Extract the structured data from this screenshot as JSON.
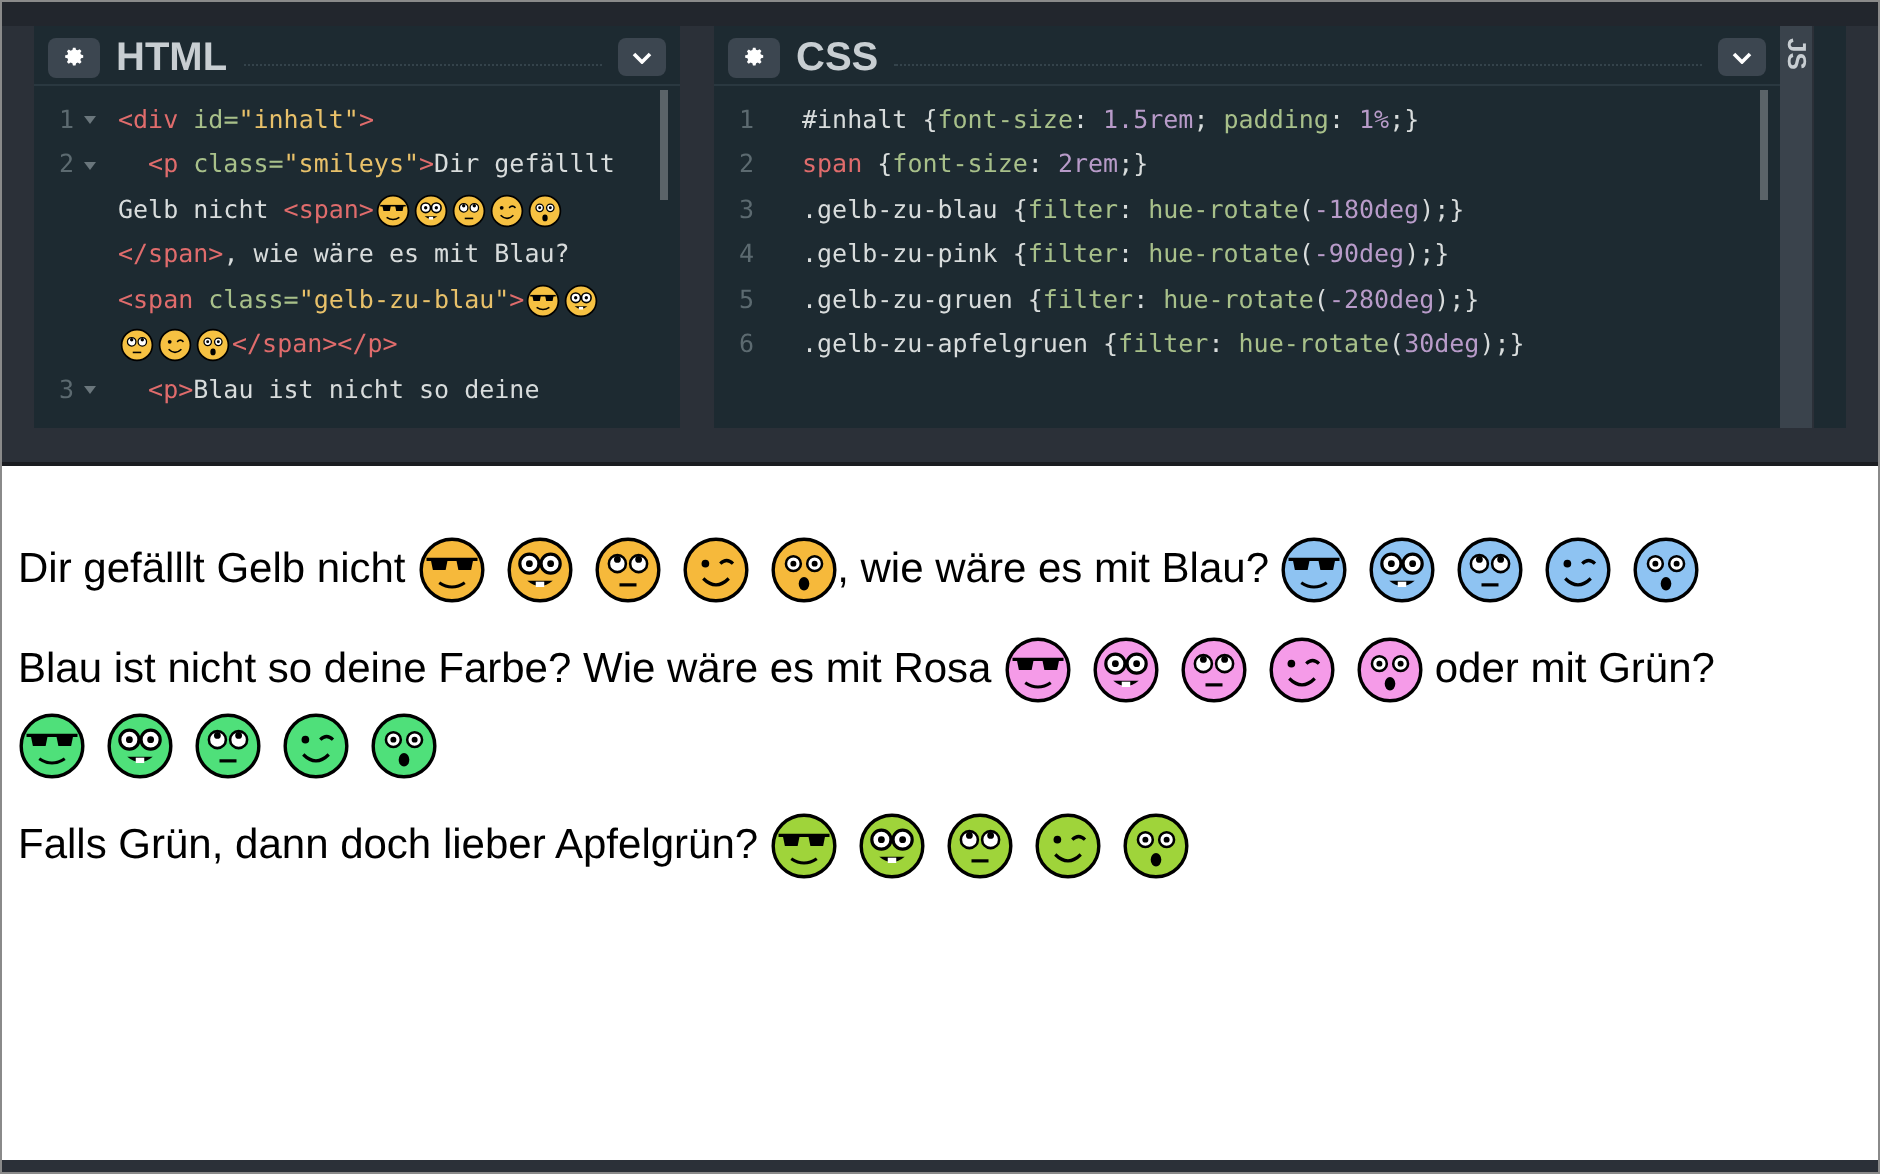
{
  "html_panel": {
    "title": "HTML",
    "lines": [
      {
        "number": "1",
        "fold": true,
        "segments": [
          {
            "kind": "tag",
            "text": "<div "
          },
          {
            "kind": "attr",
            "text": "id="
          },
          {
            "kind": "string",
            "text": "\"inhalt\""
          },
          {
            "kind": "tag",
            "text": ">"
          }
        ]
      },
      {
        "number": "2",
        "fold": true,
        "segments": [
          {
            "kind": "indent"
          },
          {
            "kind": "tag",
            "text": "<p "
          },
          {
            "kind": "attr",
            "text": "class="
          },
          {
            "kind": "string",
            "text": "\"smileys\""
          },
          {
            "kind": "tag",
            "text": ">"
          },
          {
            "kind": "text",
            "text": "Dir gefälllt"
          }
        ]
      },
      {
        "segments": [
          {
            "kind": "text",
            "text": "Gelb nicht "
          },
          {
            "kind": "tag",
            "text": "<span>"
          },
          {
            "kind": "sunglasses"
          },
          {
            "kind": "nerd"
          },
          {
            "kind": "rolling-eyes"
          },
          {
            "kind": "wink"
          },
          {
            "kind": "astonished"
          }
        ]
      },
      {
        "segments": [
          {
            "kind": "tag",
            "text": "</span>"
          },
          {
            "kind": "text",
            "text": ", wie wäre es mit Blau?"
          }
        ]
      },
      {
        "segments": [
          {
            "kind": "tag",
            "text": "<span "
          },
          {
            "kind": "attr",
            "text": "class="
          },
          {
            "kind": "string",
            "text": "\"gelb-zu-blau\""
          },
          {
            "kind": "tag",
            "text": ">"
          },
          {
            "kind": "sunglasses"
          },
          {
            "kind": "nerd"
          }
        ]
      },
      {
        "segments": [
          {
            "kind": "rolling-eyes"
          },
          {
            "kind": "wink"
          },
          {
            "kind": "astonished"
          },
          {
            "kind": "tag",
            "text": "</span></p>"
          }
        ]
      },
      {
        "number": "3",
        "fold": true,
        "segments": [
          {
            "kind": "indent"
          },
          {
            "kind": "tag",
            "text": "<p>"
          },
          {
            "kind": "text",
            "text": "Blau ist nicht so deine"
          }
        ]
      }
    ]
  },
  "css_panel": {
    "title": "CSS",
    "lines": [
      {
        "number": "1",
        "segments": [
          {
            "kind": "text",
            "text": "#inhalt {"
          },
          {
            "kind": "attr",
            "text": "font-size"
          },
          {
            "kind": "text",
            "text": ": "
          },
          {
            "kind": "value",
            "text": "1.5rem"
          },
          {
            "kind": "text",
            "text": "; "
          },
          {
            "kind": "attr",
            "text": "padding"
          },
          {
            "kind": "text",
            "text": ": "
          },
          {
            "kind": "value",
            "text": "1%"
          },
          {
            "kind": "text",
            "text": ";}"
          }
        ]
      },
      {
        "number": "2",
        "segments": [
          {
            "kind": "tag",
            "text": "span"
          },
          {
            "kind": "text",
            "text": " {"
          },
          {
            "kind": "attr",
            "text": "font-size"
          },
          {
            "kind": "text",
            "text": ": "
          },
          {
            "kind": "value",
            "text": "2rem"
          },
          {
            "kind": "text",
            "text": ";}"
          }
        ]
      },
      {
        "number": "3",
        "segments": [
          {
            "kind": "text",
            "text": ".gelb-zu-blau {"
          },
          {
            "kind": "attr",
            "text": "filter"
          },
          {
            "kind": "text",
            "text": ": "
          },
          {
            "kind": "attr",
            "text": "hue-rotate"
          },
          {
            "kind": "text",
            "text": "("
          },
          {
            "kind": "value",
            "text": "-180deg"
          },
          {
            "kind": "text",
            "text": ");}"
          }
        ]
      },
      {
        "number": "4",
        "segments": [
          {
            "kind": "text",
            "text": ".gelb-zu-pink {"
          },
          {
            "kind": "attr",
            "text": "filter"
          },
          {
            "kind": "text",
            "text": ": "
          },
          {
            "kind": "attr",
            "text": "hue-rotate"
          },
          {
            "kind": "text",
            "text": "("
          },
          {
            "kind": "value",
            "text": "-90deg"
          },
          {
            "kind": "text",
            "text": ");}"
          }
        ]
      },
      {
        "number": "5",
        "segments": [
          {
            "kind": "text",
            "text": ".gelb-zu-gruen {"
          },
          {
            "kind": "attr",
            "text": "filter"
          },
          {
            "kind": "text",
            "text": ": "
          },
          {
            "kind": "attr",
            "text": "hue-rotate"
          },
          {
            "kind": "text",
            "text": "("
          },
          {
            "kind": "value",
            "text": "-280deg"
          },
          {
            "kind": "text",
            "text": ");}"
          }
        ]
      },
      {
        "number": "6",
        "segments": [
          {
            "kind": "text",
            "text": ".gelb-zu-apfelgruen {"
          },
          {
            "kind": "attr",
            "text": "filter"
          },
          {
            "kind": "text",
            "text": ": "
          },
          {
            "kind": "attr",
            "text": "hue-rotate"
          },
          {
            "kind": "text",
            "text": "("
          },
          {
            "kind": "value",
            "text": "30deg"
          },
          {
            "kind": "text",
            "text": ");}"
          }
        ]
      }
    ]
  },
  "js_panel": {
    "title": "JS"
  },
  "preview": {
    "paragraphs": [
      [
        {
          "kind": "text",
          "text": "Dir gefälllt Gelb nicht "
        },
        {
          "kind": "faces",
          "color": "#f6b93b"
        },
        {
          "kind": "text",
          "text": ", wie wäre es mit Blau? "
        },
        {
          "kind": "faces",
          "color": "#8ec3f2"
        }
      ],
      [
        {
          "kind": "text",
          "text": "Blau ist nicht so deine Farbe? Wie wäre es mit Rosa "
        },
        {
          "kind": "faces",
          "color": "#f59be8"
        },
        {
          "kind": "text",
          "text": " oder mit Grün? "
        },
        {
          "kind": "faces",
          "color": "#4fe07a"
        }
      ],
      [
        {
          "kind": "text",
          "text": "Falls Grün, dann doch lieber Apfelgrün? "
        },
        {
          "kind": "faces",
          "color": "#9fd43a"
        }
      ]
    ]
  }
}
